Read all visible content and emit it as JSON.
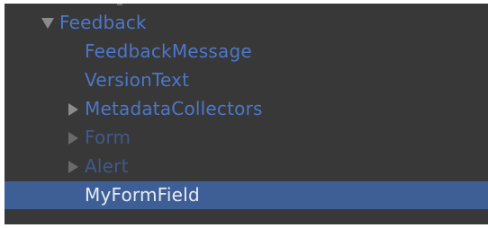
{
  "hierarchy": {
    "rows": [
      {
        "label": "Feedback",
        "expanded": true,
        "has_children": true,
        "state": "active"
      },
      {
        "label": "FeedbackMessage",
        "has_children": false,
        "state": "active"
      },
      {
        "label": "VersionText",
        "has_children": false,
        "state": "active"
      },
      {
        "label": "MetadataCollectors",
        "expanded": false,
        "has_children": true,
        "state": "active"
      },
      {
        "label": "Form",
        "expanded": false,
        "has_children": true,
        "state": "inactive"
      },
      {
        "label": "Alert",
        "expanded": false,
        "has_children": true,
        "state": "inactive"
      },
      {
        "label": "MyFormField",
        "has_children": false,
        "state": "selected"
      }
    ]
  },
  "colors": {
    "panel_background": "#383838",
    "active_text": "#4d77c9",
    "inactive_text": "#41598c",
    "selected_text": "#e7ebf3",
    "selection_background": "#3e5f96",
    "arrow": "#8c8c8c"
  },
  "icons": {
    "expanded": "triangle-down-icon",
    "collapsed": "triangle-right-icon"
  }
}
